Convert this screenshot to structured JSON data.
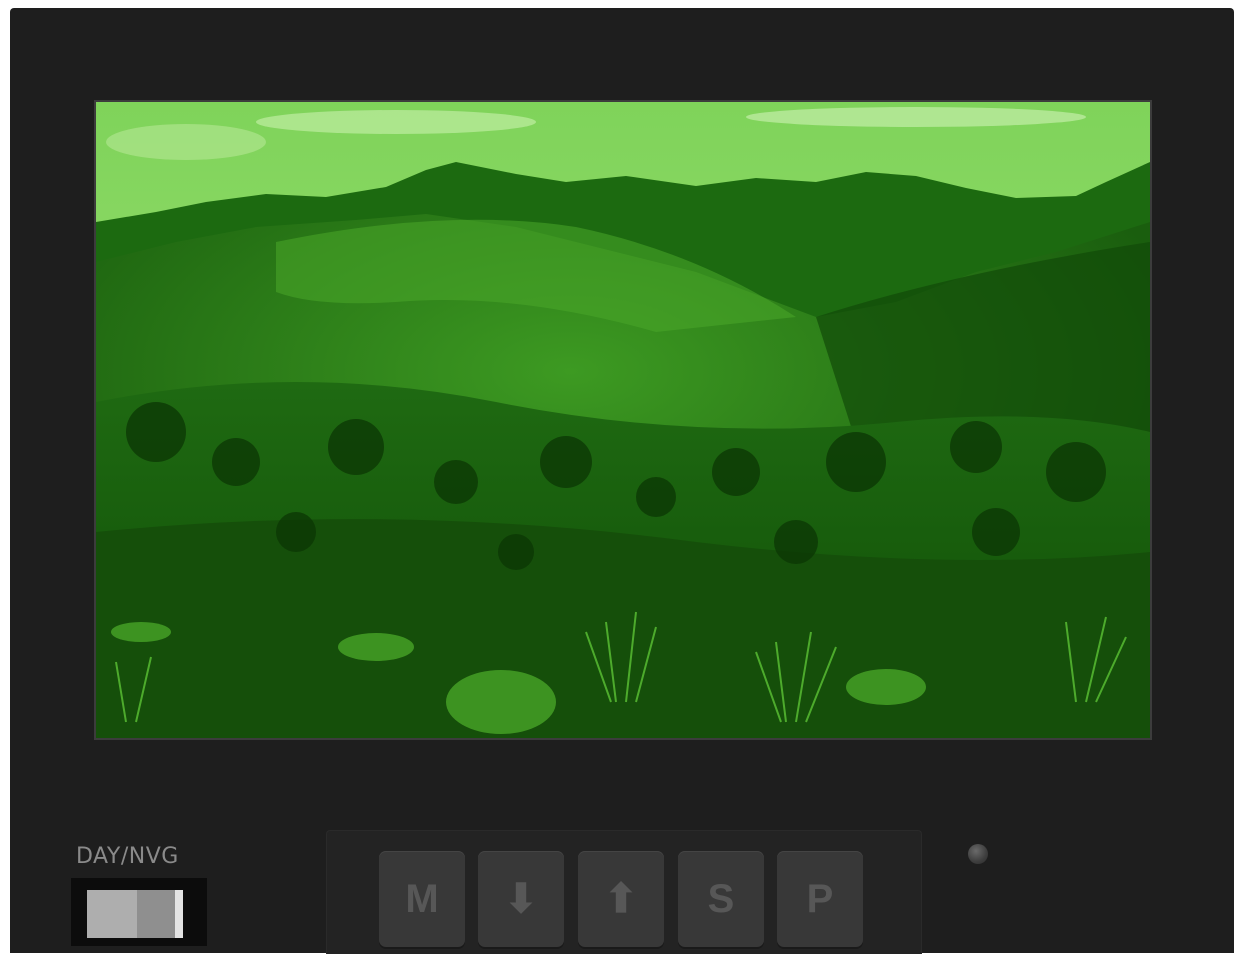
{
  "colors": {
    "bezel": "#1e1e1e",
    "nvg_tint": "#4bbd28",
    "key_face": "#383838",
    "key_glyph": "#575757",
    "label_text": "#8a8a8a"
  },
  "display": {
    "image_description_icon": "night-vision-landscape"
  },
  "mode_switch": {
    "label": "DAY/NVG"
  },
  "keypad": {
    "keys": [
      {
        "label": "M"
      },
      {
        "label": "⬇"
      },
      {
        "label": "⬆"
      },
      {
        "label": "S"
      },
      {
        "label": "P"
      }
    ]
  }
}
